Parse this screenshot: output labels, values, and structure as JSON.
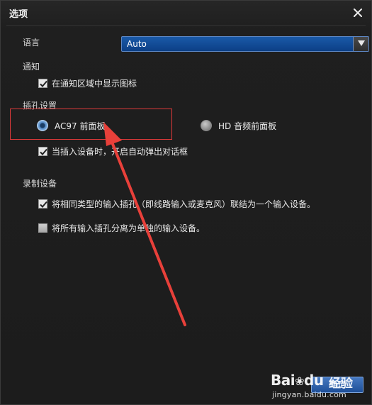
{
  "dialog": {
    "title": "选项"
  },
  "language": {
    "label": "语言",
    "selected": "Auto"
  },
  "notification": {
    "label": "通知",
    "show_icon_label": "在通知区域中显示图标",
    "show_icon_checked": true
  },
  "jack_settings": {
    "label": "插孔设置",
    "options": [
      {
        "label": "AC97 前面板",
        "selected": true
      },
      {
        "label": "HD 音频前面板",
        "selected": false
      }
    ],
    "auto_popup_label": "当插入设备时，开启自动弹出对话框",
    "auto_popup_checked": true
  },
  "recording": {
    "label": "录制设备",
    "combine_label": "将相同类型的输入插孔（即线路输入或麦克风）联结为一个输入设备。",
    "combine_checked": true,
    "separate_label": "将所有输入插孔分离为单独的输入设备。",
    "separate_checked": false
  },
  "footer": {
    "ok_label": "确定"
  },
  "watermark": {
    "brand": "Bai",
    "brand_suffix": "du",
    "word": "经验",
    "url": "jingyan.baidu.com"
  },
  "colors": {
    "accent": "#1a5aa8",
    "annotation": "#e8403a"
  }
}
